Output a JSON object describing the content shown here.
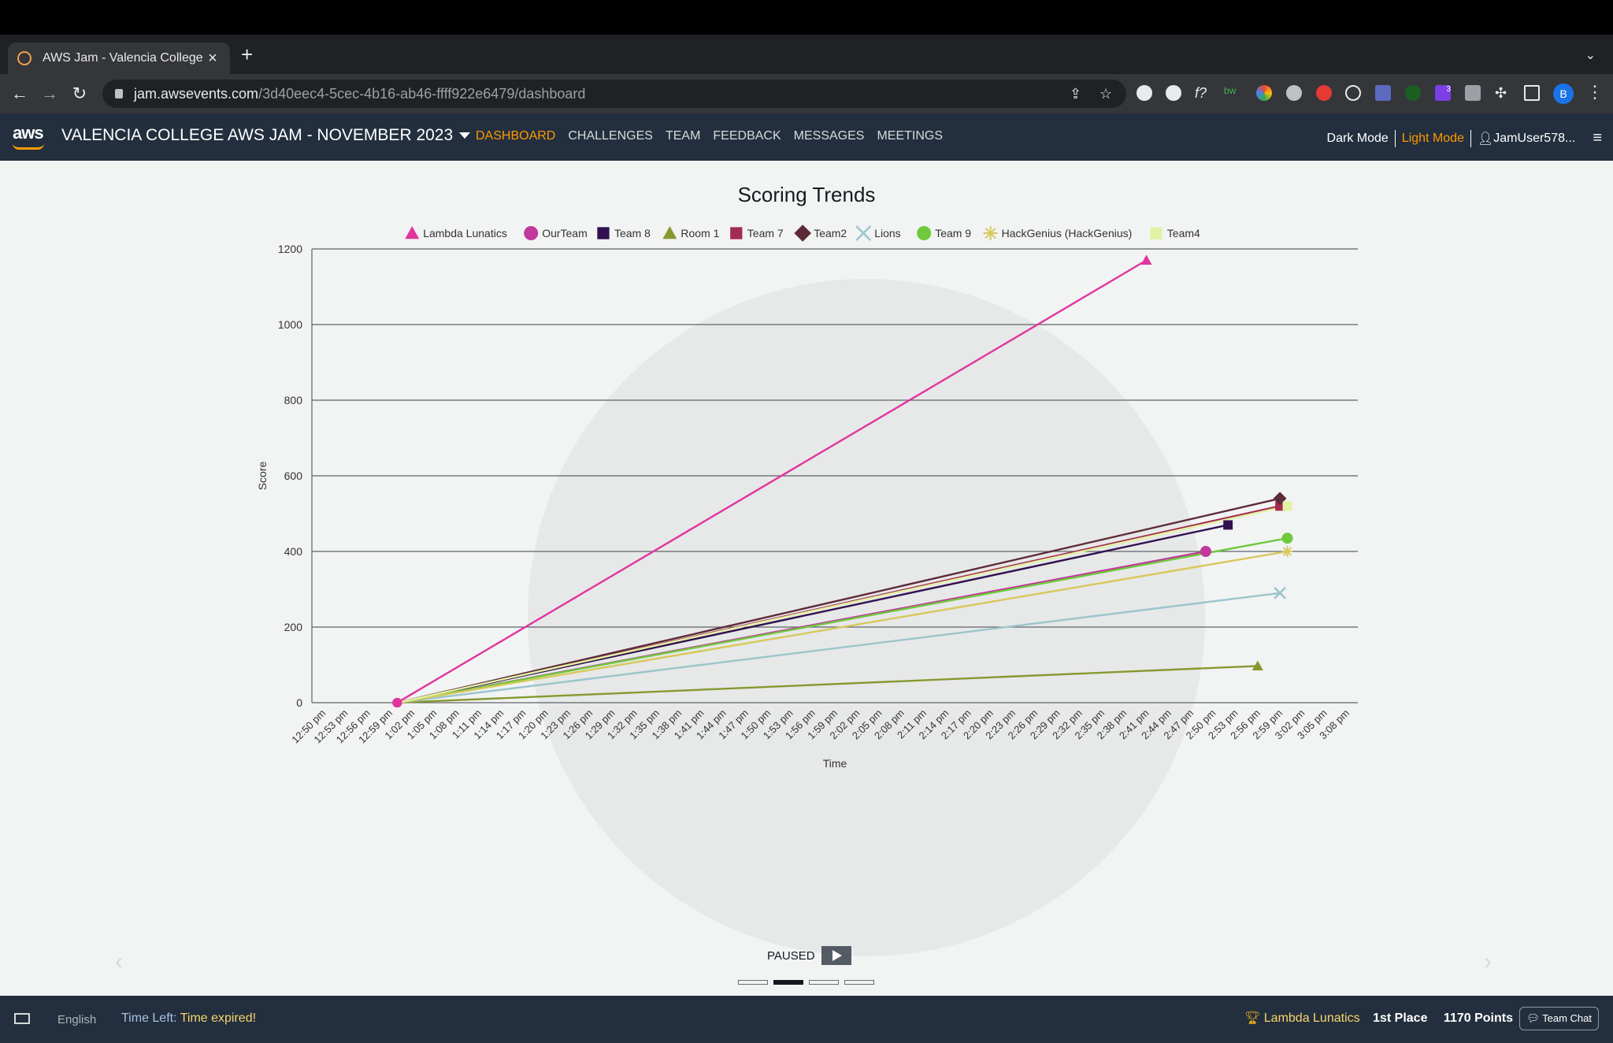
{
  "browser": {
    "tab_title": "AWS Jam - Valencia College A",
    "url_host": "jam.awsevents.com",
    "url_path": "/3d40eec4-5cec-4b16-ab46-ffff922e6479/dashboard",
    "extensions_badge": "3",
    "profile_initial": "B"
  },
  "header": {
    "logo_text": "aws",
    "event_title": "VALENCIA COLLEGE AWS JAM - NOVEMBER 2023",
    "nav": [
      "DASHBOARD",
      "CHALLENGES",
      "TEAM",
      "FEEDBACK",
      "MESSAGES",
      "MEETINGS"
    ],
    "active_nav": "DASHBOARD",
    "dark_mode": "Dark Mode",
    "light_mode": "Light Mode",
    "user": "JamUser578..."
  },
  "carousel": {
    "status": "PAUSED",
    "slides": 4,
    "active_slide": 2
  },
  "footer": {
    "language": "English",
    "time_left_label": "Time Left:",
    "time_left_value": "Time expired!",
    "leader_team": "Lambda Lunatics",
    "leader_place": "1st Place",
    "leader_points": "1170 Points",
    "team_chat": "Team Chat"
  },
  "chart_data": {
    "type": "line",
    "title": "Scoring Trends",
    "xlabel": "Time",
    "ylabel": "Score",
    "ylim": [
      0,
      1200
    ],
    "yticks": [
      0,
      200,
      400,
      600,
      800,
      1000,
      1200
    ],
    "x_ticks": [
      "12:50 pm",
      "12:53 pm",
      "12:56 pm",
      "12:59 pm",
      "1:02 pm",
      "1:05 pm",
      "1:08 pm",
      "1:11 pm",
      "1:14 pm",
      "1:17 pm",
      "1:20 pm",
      "1:23 pm",
      "1:26 pm",
      "1:29 pm",
      "1:32 pm",
      "1:35 pm",
      "1:38 pm",
      "1:41 pm",
      "1:44 pm",
      "1:47 pm",
      "1:50 pm",
      "1:53 pm",
      "1:56 pm",
      "1:59 pm",
      "2:02 pm",
      "2:05 pm",
      "2:08 pm",
      "2:11 pm",
      "2:14 pm",
      "2:17 pm",
      "2:20 pm",
      "2:23 pm",
      "2:26 pm",
      "2:29 pm",
      "2:32 pm",
      "2:35 pm",
      "2:38 pm",
      "2:41 pm",
      "2:44 pm",
      "2:47 pm",
      "2:50 pm",
      "2:53 pm",
      "2:56 pm",
      "2:59 pm",
      "3:02 pm",
      "3:05 pm",
      "3:08 pm"
    ],
    "grid": true,
    "legend": "top",
    "series": [
      {
        "name": "Lambda Lunatics",
        "color": "#e0359f",
        "marker": "triangle",
        "points": [
          [
            "1:00 pm",
            0
          ],
          [
            "2:41 pm",
            1170
          ]
        ]
      },
      {
        "name": "OurTeam",
        "color": "#c0399b",
        "marker": "circle",
        "points": [
          [
            "1:00 pm",
            0
          ],
          [
            "2:49 pm",
            400
          ]
        ]
      },
      {
        "name": "Team 8",
        "color": "#32104f",
        "marker": "square",
        "points": [
          [
            "1:00 pm",
            0
          ],
          [
            "2:52 pm",
            470
          ]
        ]
      },
      {
        "name": "Room 1",
        "color": "#86992f",
        "marker": "triangle",
        "points": [
          [
            "1:00 pm",
            0
          ],
          [
            "2:56 pm",
            97
          ]
        ]
      },
      {
        "name": "Team 7",
        "color": "#a32b50",
        "marker": "square",
        "points": [
          [
            "1:00 pm",
            0
          ],
          [
            "2:59 pm",
            520
          ]
        ]
      },
      {
        "name": "Team2",
        "color": "#5d2a37",
        "marker": "diamond",
        "points": [
          [
            "1:00 pm",
            0
          ],
          [
            "2:59 pm",
            540
          ]
        ]
      },
      {
        "name": "Lions",
        "color": "#9bc5cd",
        "marker": "cross",
        "points": [
          [
            "1:00 pm",
            0
          ],
          [
            "2:59 pm",
            290
          ]
        ]
      },
      {
        "name": "Team 9",
        "color": "#6fc93c",
        "marker": "circle",
        "points": [
          [
            "1:00 pm",
            0
          ],
          [
            "3:00 pm",
            435
          ]
        ]
      },
      {
        "name": "HackGenius (HackGenius)",
        "color": "#d6c95b",
        "marker": "star",
        "points": [
          [
            "1:00 pm",
            0
          ],
          [
            "3:00 pm",
            400
          ]
        ]
      },
      {
        "name": "Team4",
        "color": "#e2f2a5",
        "marker": "square",
        "points": [
          [
            "1:00 pm",
            0
          ],
          [
            "3:00 pm",
            520
          ]
        ]
      }
    ]
  }
}
